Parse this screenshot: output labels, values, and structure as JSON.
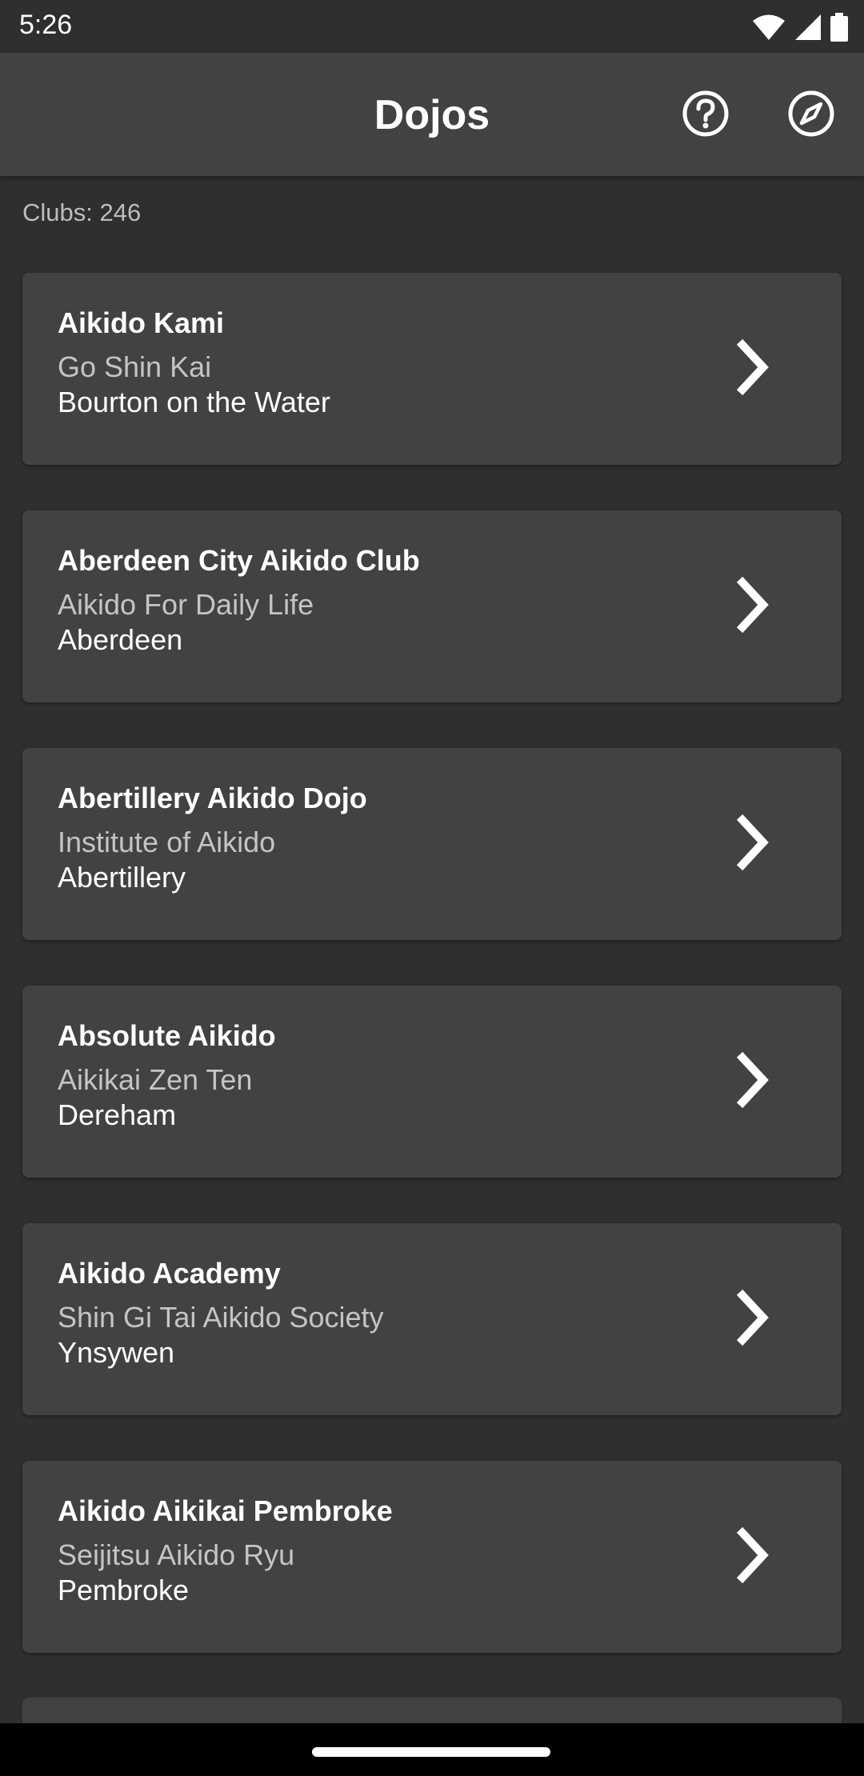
{
  "status_bar": {
    "time": "5:26"
  },
  "app_bar": {
    "title": "Dojos",
    "help_icon": "help-circle-icon",
    "compass_icon": "compass-icon"
  },
  "clubs_count": "Clubs: 246",
  "clubs": [
    {
      "name": "Aikido Kami",
      "organisation": "Go Shin Kai",
      "town": "Bourton on the Water"
    },
    {
      "name": "Aberdeen City Aikido Club",
      "organisation": "Aikido For Daily Life",
      "town": "Aberdeen"
    },
    {
      "name": "Abertillery Aikido Dojo",
      "organisation": "Institute of Aikido",
      "town": "Abertillery"
    },
    {
      "name": "Absolute Aikido",
      "organisation": "Aikikai Zen Ten",
      "town": "Dereham"
    },
    {
      "name": "Aikido Academy",
      "organisation": "Shin Gi Tai Aikido Society",
      "town": "Ynsywen"
    },
    {
      "name": "Aikido Aikikai Pembroke",
      "organisation": "Seijitsu Aikido Ryu",
      "town": "Pembroke"
    }
  ],
  "colors": {
    "background": "#2f2f2f",
    "card": "#424242",
    "app_bar": "#424242",
    "secondary_text": "#c4c4c4"
  }
}
